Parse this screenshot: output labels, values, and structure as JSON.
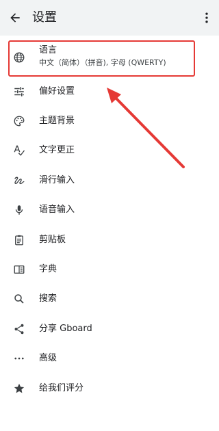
{
  "header": {
    "title": "设置"
  },
  "items": [
    {
      "label": "语言",
      "sublabel": "中文（简体）（拼音), 字母 (QWERTY)",
      "icon": "globe-icon"
    },
    {
      "label": "偏好设置",
      "icon": "tune-icon"
    },
    {
      "label": "主题背景",
      "icon": "palette-icon"
    },
    {
      "label": "文字更正",
      "icon": "spellcheck-icon"
    },
    {
      "label": "滑行输入",
      "icon": "gesture-icon"
    },
    {
      "label": "语音输入",
      "icon": "microphone-icon"
    },
    {
      "label": "剪贴板",
      "icon": "clipboard-icon"
    },
    {
      "label": "字典",
      "icon": "dictionary-icon"
    },
    {
      "label": "搜索",
      "icon": "search-icon"
    },
    {
      "label": "分享 Gboard",
      "icon": "share-icon"
    },
    {
      "label": "高级",
      "icon": "more-horiz-icon"
    },
    {
      "label": "给我们评分",
      "icon": "star-icon"
    }
  ],
  "colors": {
    "accent": "#e53935",
    "appbar": "#f1f3f4",
    "icon": "#3c4043"
  }
}
